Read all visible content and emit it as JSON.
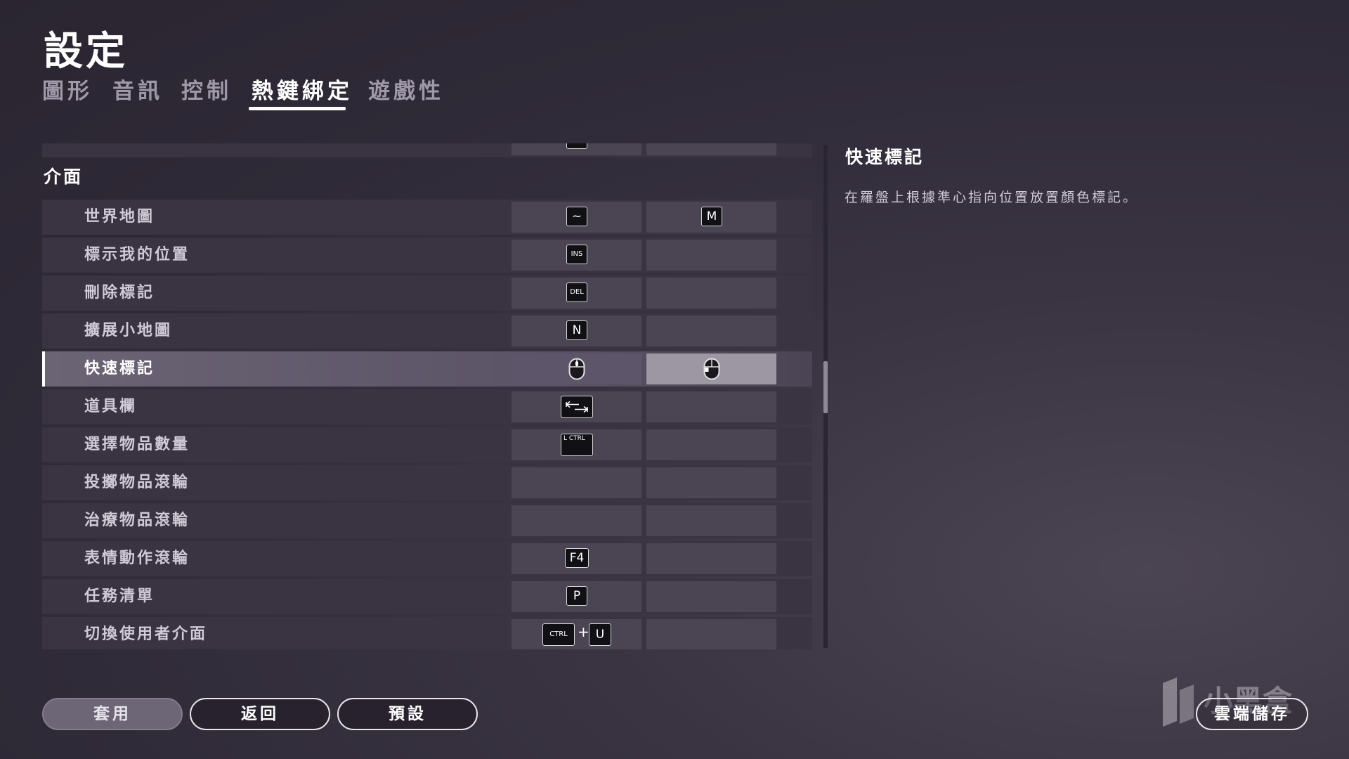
{
  "header": {
    "title": "設定"
  },
  "tabs": [
    {
      "label": "圖形",
      "active": false
    },
    {
      "label": "音訊",
      "active": false
    },
    {
      "label": "控制",
      "active": false
    },
    {
      "label": "熱鍵綁定",
      "active": true
    },
    {
      "label": "遊戲性",
      "active": false
    }
  ],
  "bindings": {
    "prev_row": {
      "key": "G"
    },
    "section_title": "介面",
    "rows": [
      {
        "label": "世界地圖",
        "primary": "~",
        "secondary": "M"
      },
      {
        "label": "標示我的位置",
        "primary": "INS",
        "secondary": ""
      },
      {
        "label": "刪除標記",
        "primary": "DEL",
        "secondary": ""
      },
      {
        "label": "擴展小地圖",
        "primary": "N",
        "secondary": ""
      },
      {
        "label": "快速標記",
        "primary": "mouse-middle-icon",
        "secondary": "mouse-button-4-icon",
        "selected": true
      },
      {
        "label": "道具欄",
        "primary": "tab-key-icon",
        "secondary": ""
      },
      {
        "label": "選擇物品數量",
        "primary": "L CTRL",
        "secondary": ""
      },
      {
        "label": "投擲物品滾輪",
        "primary": "",
        "secondary": ""
      },
      {
        "label": "治療物品滾輪",
        "primary": "",
        "secondary": ""
      },
      {
        "label": "表情動作滾輪",
        "primary": "F4",
        "secondary": ""
      },
      {
        "label": "任務清單",
        "primary": "P",
        "secondary": ""
      },
      {
        "label": "切換使用者介面",
        "primary": "CTRL",
        "primary_plus": "+",
        "primary_second": "U",
        "secondary": ""
      }
    ]
  },
  "description": {
    "title": "快速標記",
    "text": "在羅盤上根據準心指向位置放置顏色標記。"
  },
  "footer": {
    "apply": "套用",
    "back": "返回",
    "defaults": "預設",
    "cloud_save": "雲端儲存"
  },
  "watermark": {
    "text": "小黑盒"
  },
  "colors": {
    "background": "#2f2a37",
    "row": "#3a3442",
    "slot": "#4a4453",
    "accent": "#ffffff"
  }
}
